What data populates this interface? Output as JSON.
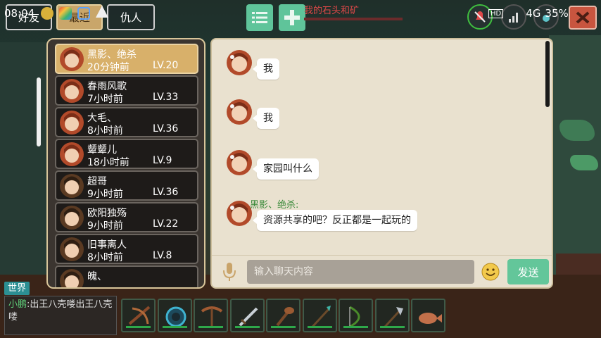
{
  "status_bar": {
    "time": "08:04",
    "network": "4G",
    "battery": "35%"
  },
  "tabs": {
    "friends": "好友",
    "recent": "最近",
    "enemies": "仇人"
  },
  "quest": {
    "text": "我的石头和矿"
  },
  "friends": [
    {
      "name": "黑影、绝杀",
      "time": "20分钟前",
      "level": "LV.20",
      "active": true
    },
    {
      "name": "春雨风歌",
      "time": "7小时前",
      "level": "LV.33"
    },
    {
      "name": "大毛、",
      "time": "8小时前",
      "level": "LV.36"
    },
    {
      "name": "颦颦儿",
      "time": "18小时前",
      "level": "LV.9"
    },
    {
      "name": "超哥",
      "time": "9小时前",
      "level": "LV.36"
    },
    {
      "name": "欧阳独殇",
      "time": "9小时前",
      "level": "LV.22"
    },
    {
      "name": "旧事离人",
      "time": "8小时前",
      "level": "LV.8"
    },
    {
      "name": "魄、",
      "time": "",
      "level": ""
    }
  ],
  "messages": [
    {
      "sender": "",
      "text": "我"
    },
    {
      "sender": "",
      "text": "我"
    },
    {
      "sender": "",
      "text": "家园叫什么"
    },
    {
      "sender": "黑影、绝杀:",
      "text": "资源共享的吧？反正都是一起玩的"
    }
  ],
  "chat_input": {
    "placeholder": "输入聊天内容",
    "send_label": "发送"
  },
  "world_chat": {
    "tag": "世界",
    "sender": "小鹏",
    "separator": ":",
    "message": "出王八壳喽出王八壳喽"
  },
  "hotbar": [
    "crossbow-icon",
    "orb-icon",
    "pickaxe-icon",
    "sword-icon",
    "club-icon",
    "spear-icon",
    "bow-icon",
    "axe-icon",
    "fish-icon"
  ],
  "colors": {
    "accent_green": "#63c69a",
    "active_tab": "#c9a66a",
    "panel_border": "#d8c59a",
    "chat_bg": "#e9e1cf"
  }
}
